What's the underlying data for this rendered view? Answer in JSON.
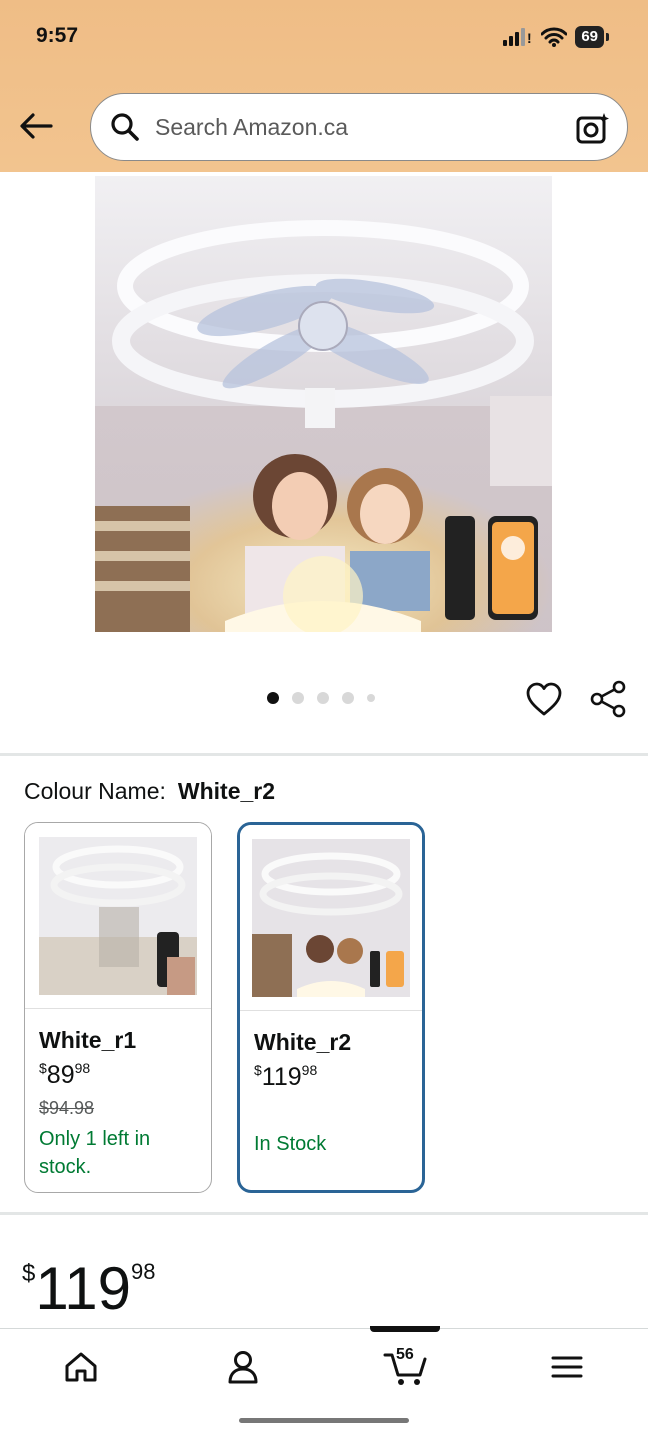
{
  "status_bar": {
    "time": "9:57",
    "battery": "69"
  },
  "search": {
    "placeholder": "Search Amazon.ca"
  },
  "gallery": {
    "dot_count": 5,
    "active_index": 0
  },
  "colour": {
    "label": "Colour Name:",
    "selected": "White_r2",
    "options": [
      {
        "name": "White_r1",
        "price_whole": "89",
        "price_cents": "98",
        "currency": "$",
        "was_price": "$94.98",
        "stock": "Only 1 left in stock."
      },
      {
        "name": "White_r2",
        "price_whole": "119",
        "price_cents": "98",
        "currency": "$",
        "was_price": "",
        "stock": "In Stock"
      }
    ]
  },
  "price": {
    "currency": "$",
    "whole": "119",
    "cents": "98"
  },
  "nav": {
    "cart_count": "56",
    "items": [
      "home-icon",
      "account-icon",
      "cart-icon",
      "menu-icon"
    ]
  },
  "colors": {
    "header": "#f0bf88",
    "selected_border": "#2a6496",
    "stock_green": "#007a33"
  }
}
